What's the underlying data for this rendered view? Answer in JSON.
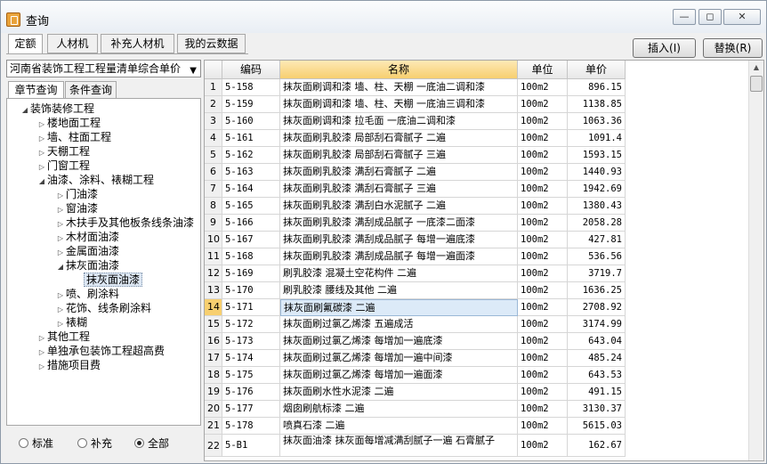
{
  "window": {
    "title": "查询",
    "min": "—",
    "max": "◻",
    "close": "✕"
  },
  "top_tabs": [
    "定额",
    "人材机",
    "补充人材机",
    "我的云数据"
  ],
  "buttons": {
    "insert": "插入(I)",
    "replace": "替换(R)"
  },
  "library_select": {
    "value": "河南省装饰工程工程量清单综合单价"
  },
  "sub_tabs": [
    "章节查询",
    "条件查询"
  ],
  "tree": [
    {
      "label": "装饰装修工程",
      "toggle": "◢"
    },
    {
      "label": "楼地面工程",
      "toggle": "▷"
    },
    {
      "label": "墙、柱面工程",
      "toggle": "▷"
    },
    {
      "label": "天棚工程",
      "toggle": "▷"
    },
    {
      "label": "门窗工程",
      "toggle": "▷"
    },
    {
      "label": "油漆、涂料、裱糊工程",
      "toggle": "◢"
    },
    {
      "label": "门油漆",
      "toggle": "▷"
    },
    {
      "label": "窗油漆",
      "toggle": "▷"
    },
    {
      "label": "木扶手及其他板条线条油漆",
      "toggle": "▷"
    },
    {
      "label": "木材面油漆",
      "toggle": "▷"
    },
    {
      "label": "金属面油漆",
      "toggle": "▷"
    },
    {
      "label": "抹灰面油漆",
      "toggle": "◢"
    },
    {
      "label": "抹灰面油漆",
      "toggle": ""
    },
    {
      "label": "喷、刷涂料",
      "toggle": "▷"
    },
    {
      "label": "花饰、线条刷涂料",
      "toggle": "▷"
    },
    {
      "label": "裱糊",
      "toggle": "▷"
    },
    {
      "label": "其他工程",
      "toggle": "▷"
    },
    {
      "label": "单独承包装饰工程超高费",
      "toggle": "▷"
    },
    {
      "label": "措施项目费",
      "toggle": "▷"
    }
  ],
  "filters": {
    "options": [
      "标准",
      "补充",
      "全部"
    ],
    "selected": "全部"
  },
  "table": {
    "columns": [
      "编码",
      "名称",
      "单位",
      "单价"
    ],
    "rows": [
      {
        "no": "1",
        "code": "5-158",
        "name": "抹灰面刷调和漆 墙、柱、天棚 一底油二调和漆",
        "unit": "100m2",
        "price": "896.15"
      },
      {
        "no": "2",
        "code": "5-159",
        "name": "抹灰面刷调和漆 墙、柱、天棚 一底油三调和漆",
        "unit": "100m2",
        "price": "1138.85"
      },
      {
        "no": "3",
        "code": "5-160",
        "name": "抹灰面刷调和漆 拉毛面 一底油二调和漆",
        "unit": "100m2",
        "price": "1063.36"
      },
      {
        "no": "4",
        "code": "5-161",
        "name": "抹灰面刷乳胶漆 局部刮石膏腻子 二遍",
        "unit": "100m2",
        "price": "1091.4"
      },
      {
        "no": "5",
        "code": "5-162",
        "name": "抹灰面刷乳胶漆 局部刮石膏腻子 三遍",
        "unit": "100m2",
        "price": "1593.15"
      },
      {
        "no": "6",
        "code": "5-163",
        "name": "抹灰面刷乳胶漆 满刮石膏腻子 二遍",
        "unit": "100m2",
        "price": "1440.93"
      },
      {
        "no": "7",
        "code": "5-164",
        "name": "抹灰面刷乳胶漆 满刮石膏腻子 三遍",
        "unit": "100m2",
        "price": "1942.69"
      },
      {
        "no": "8",
        "code": "5-165",
        "name": "抹灰面刷乳胶漆 满刮白水泥腻子 二遍",
        "unit": "100m2",
        "price": "1380.43"
      },
      {
        "no": "9",
        "code": "5-166",
        "name": "抹灰面刷乳胶漆 满刮成品腻子 一底漆二面漆",
        "unit": "100m2",
        "price": "2058.28"
      },
      {
        "no": "10",
        "code": "5-167",
        "name": "抹灰面刷乳胶漆 满刮成品腻子 每增一遍底漆",
        "unit": "100m2",
        "price": "427.81"
      },
      {
        "no": "11",
        "code": "5-168",
        "name": "抹灰面刷乳胶漆 满刮成品腻子 每增一遍面漆",
        "unit": "100m2",
        "price": "536.56"
      },
      {
        "no": "12",
        "code": "5-169",
        "name": "刷乳胶漆 混凝土空花构件 二遍",
        "unit": "100m2",
        "price": "3719.7"
      },
      {
        "no": "13",
        "code": "5-170",
        "name": "刷乳胶漆 腰线及其他 二遍",
        "unit": "100m2",
        "price": "1636.25"
      },
      {
        "no": "14",
        "code": "5-171",
        "name": "抹灰面刷氟碳漆 二遍",
        "unit": "100m2",
        "price": "2708.92"
      },
      {
        "no": "15",
        "code": "5-172",
        "name": "抹灰面刷过氯乙烯漆 五遍成活",
        "unit": "100m2",
        "price": "3174.99"
      },
      {
        "no": "16",
        "code": "5-173",
        "name": "抹灰面刷过氯乙烯漆 每增加一遍底漆",
        "unit": "100m2",
        "price": "643.04"
      },
      {
        "no": "17",
        "code": "5-174",
        "name": "抹灰面刷过氯乙烯漆 每增加一遍中间漆",
        "unit": "100m2",
        "price": "485.24"
      },
      {
        "no": "18",
        "code": "5-175",
        "name": "抹灰面刷过氯乙烯漆 每增加一遍面漆",
        "unit": "100m2",
        "price": "643.53"
      },
      {
        "no": "19",
        "code": "5-176",
        "name": "抹灰面刷水性水泥漆 二遍",
        "unit": "100m2",
        "price": "491.15"
      },
      {
        "no": "20",
        "code": "5-177",
        "name": "烟囱刷航标漆 二遍",
        "unit": "100m2",
        "price": "3130.37"
      },
      {
        "no": "21",
        "code": "5-178",
        "name": "喷真石漆 二遍",
        "unit": "100m2",
        "price": "5615.03"
      },
      {
        "no": "22",
        "code": "5-B1",
        "name": "抹灰面油漆 抹灰面每增减满刮腻子一遍 石膏腻子",
        "unit": "100m2",
        "price": "162.67"
      }
    ],
    "selected_row": 14
  }
}
